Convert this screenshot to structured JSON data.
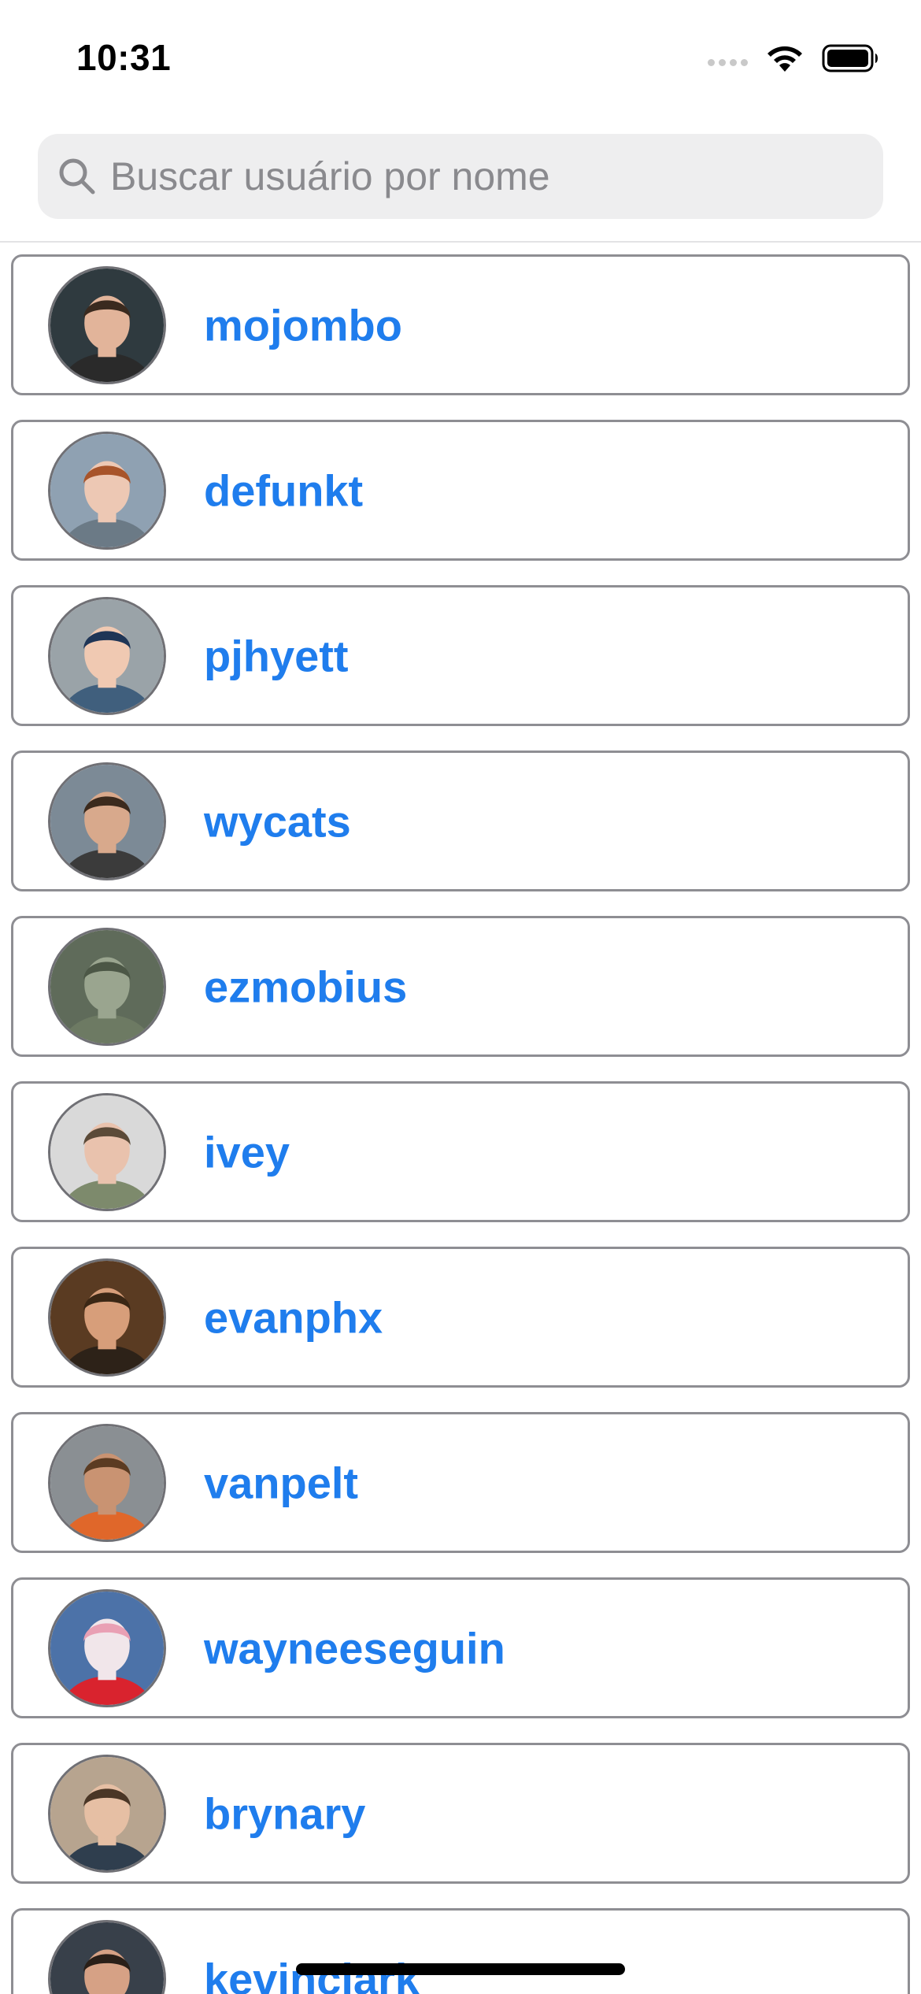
{
  "status_bar": {
    "time": "10:31"
  },
  "search": {
    "placeholder": "Buscar usuário por nome",
    "value": ""
  },
  "users": [
    {
      "name": "mojombo",
      "avatar": {
        "bg": "#2f3a3f",
        "skin": "#e2b49a",
        "hair": "#3a2a1f",
        "shirt": "#2a2a2a"
      }
    },
    {
      "name": "defunkt",
      "avatar": {
        "bg": "#8fa1b2",
        "skin": "#edc8b4",
        "hair": "#a8542a",
        "shirt": "#6b7a86"
      }
    },
    {
      "name": "pjhyett",
      "avatar": {
        "bg": "#9aa3a8",
        "skin": "#f0c9b2",
        "hair": "#1f3556",
        "shirt": "#405f7d"
      }
    },
    {
      "name": "wycats",
      "avatar": {
        "bg": "#7c8a96",
        "skin": "#d8a98c",
        "hair": "#3b2a1d",
        "shirt": "#3b3b3b"
      }
    },
    {
      "name": "ezmobius",
      "avatar": {
        "bg": "#5f6b5a",
        "skin": "#9aa58f",
        "hair": "#4c5746",
        "shirt": "#6d7a63"
      }
    },
    {
      "name": "ivey",
      "avatar": {
        "bg": "#d9d9d9",
        "skin": "#e9c2ad",
        "hair": "#5b4a38",
        "shirt": "#7d8a6c"
      }
    },
    {
      "name": "evanphx",
      "avatar": {
        "bg": "#5a3b22",
        "skin": "#d79e7a",
        "hair": "#3b2715",
        "shirt": "#2d2218"
      }
    },
    {
      "name": "vanpelt",
      "avatar": {
        "bg": "#8a8f93",
        "skin": "#c99372",
        "hair": "#5b3b22",
        "shirt": "#e0672a"
      }
    },
    {
      "name": "wayneeseguin",
      "avatar": {
        "bg": "#4c72a8",
        "skin": "#f1e6ea",
        "hair": "#e9a0b4",
        "shirt": "#d9232e"
      }
    },
    {
      "name": "brynary",
      "avatar": {
        "bg": "#b7a48f",
        "skin": "#e6bfa4",
        "hair": "#4a3626",
        "shirt": "#2f3e4e"
      }
    },
    {
      "name": "kevinclark",
      "avatar": {
        "bg": "#38404a",
        "skin": "#d6a185",
        "hair": "#2a1f18",
        "shirt": "#1c1c1c"
      }
    }
  ],
  "colors": {
    "accent": "#1f7ded",
    "row_border": "#8e8e93",
    "search_bg": "#eeeeef"
  }
}
